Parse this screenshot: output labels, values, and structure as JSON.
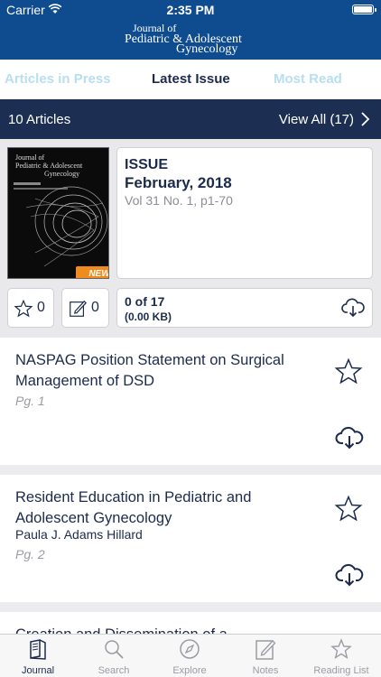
{
  "status_bar": {
    "carrier": "Carrier",
    "time": "2:35 PM"
  },
  "header": {
    "logo_line1": "Journal of",
    "logo_line2": "Pediatric & Adolescent",
    "logo_line3": "Gynecology"
  },
  "tabs": [
    {
      "label": "Articles in Press",
      "active": false
    },
    {
      "label": "Latest Issue",
      "active": true
    },
    {
      "label": "Most Read",
      "active": false
    }
  ],
  "articles_bar": {
    "count_label": "10 Articles",
    "view_all_label": "View All (17)"
  },
  "issue": {
    "cover_line1": "Journal of",
    "cover_line2": "Pediatric & Adolescent",
    "cover_line3": "Gynecology",
    "badge": "NEW",
    "label": "ISSUE",
    "date": "February, 2018",
    "volume": "Vol 31 No. 1, p1-70",
    "bookmarks_count": "0",
    "notes_count": "0",
    "download_progress": "0 of 17",
    "download_size": "(0.00 KB)"
  },
  "articles": [
    {
      "title": "NASPAG Position Statement on Surgical Management of DSD",
      "author": "",
      "page": "Pg. 1"
    },
    {
      "title": "Resident Education in Pediatric and Adolescent Gynecology",
      "author": "Paula J. Adams Hillard",
      "page": "Pg. 2"
    },
    {
      "title": "Creation and Dissemination of a",
      "author": "",
      "page": ""
    }
  ],
  "tab_bar": [
    {
      "label": "Journal",
      "icon": "journal-icon",
      "active": true
    },
    {
      "label": "Search",
      "icon": "search-icon",
      "active": false
    },
    {
      "label": "Explore",
      "icon": "compass-icon",
      "active": false
    },
    {
      "label": "Notes",
      "icon": "notes-icon",
      "active": false
    },
    {
      "label": "Reading List",
      "icon": "star-icon",
      "active": false
    }
  ],
  "colors": {
    "header_blue": "#0f4c8f",
    "navy": "#1c2f52",
    "badge_orange": "#f08b1d",
    "inactive_tab": "#b9def0"
  }
}
